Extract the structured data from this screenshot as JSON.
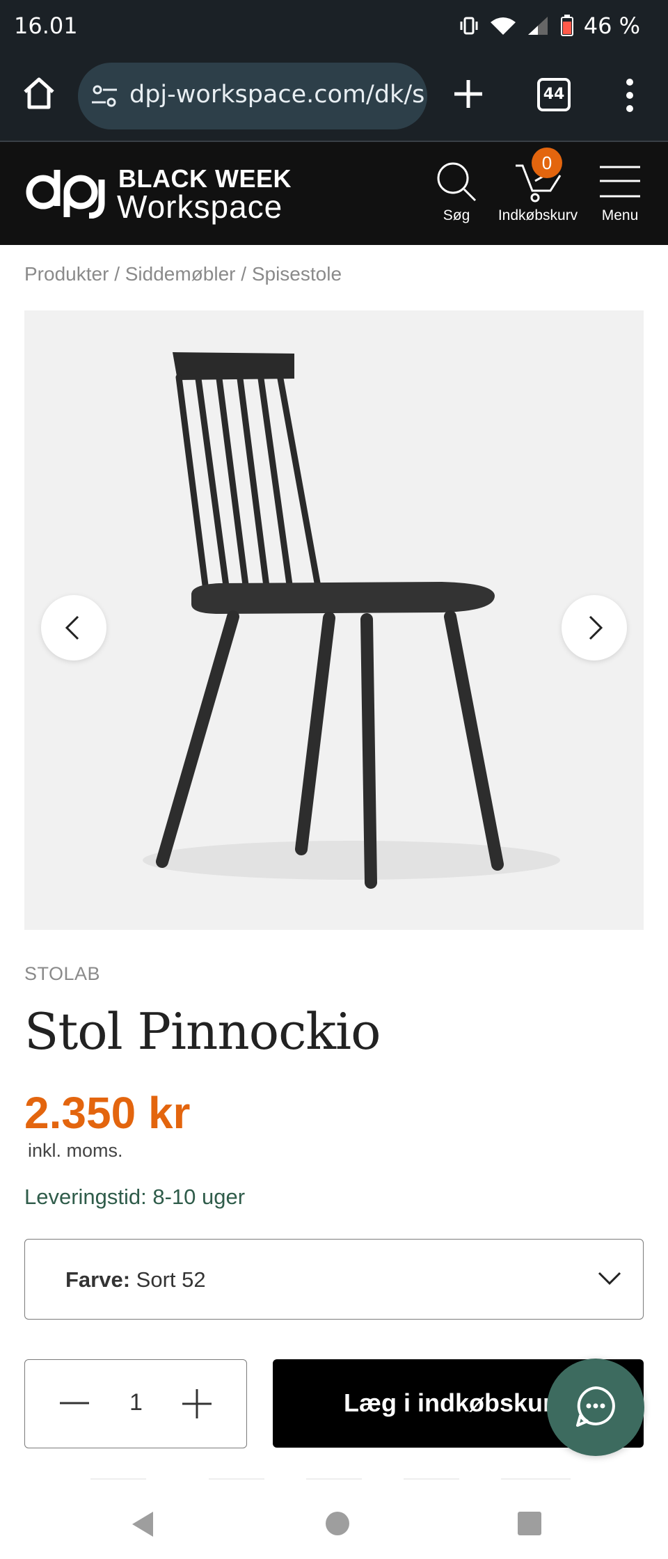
{
  "status_bar": {
    "time": "16.01",
    "battery": "46 %"
  },
  "browser": {
    "url": "dpj-workspace.com/dk/s",
    "tab_count": "44"
  },
  "header": {
    "brand_line1": "BLACK WEEK",
    "brand_line2": "Workspace",
    "search_label": "Søg",
    "cart_label": "Indkøbskurv",
    "cart_count": "0",
    "menu_label": "Menu"
  },
  "breadcrumb": {
    "items": [
      "Produkter",
      "Siddemøbler",
      "Spisestole"
    ],
    "separator": "/"
  },
  "product": {
    "brand": "STOLAB",
    "title": "Stol Pinnockio",
    "price": "2.350 kr",
    "vat_note": "inkl. moms.",
    "delivery": "Leveringstid: 8-10 uger",
    "variant_label": "Farve:",
    "variant_value": "Sort 52",
    "quantity": "1",
    "add_to_cart": "Læg i indkøbskurv"
  },
  "colors": {
    "accent": "#e3650e",
    "chat": "#3d6b5f",
    "header_bg": "#111111",
    "delivery_text": "#2f5c4a"
  },
  "icons": [
    "home-icon",
    "tune-icon",
    "plus-icon",
    "tabs-icon",
    "more-vert-icon",
    "search-icon",
    "cart-icon",
    "menu-icon",
    "chevron-left-icon",
    "chevron-right-icon",
    "chevron-down-icon",
    "minus-icon",
    "chat-icon"
  ]
}
